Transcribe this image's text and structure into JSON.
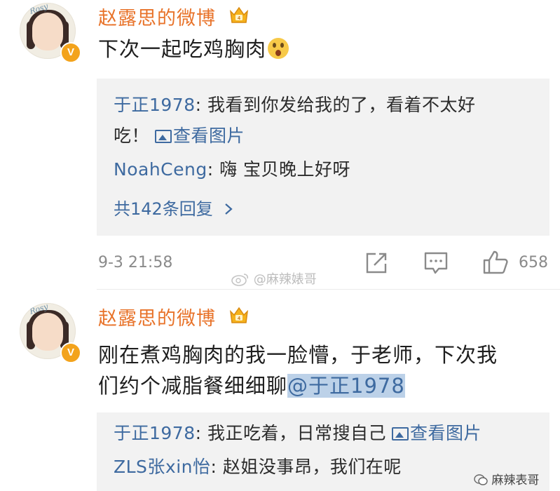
{
  "posts": [
    {
      "author": "赵露思的微博",
      "avatar_text": "Rosy",
      "verified": "V",
      "text": "下次一起吃鸡胸肉",
      "emoji": "surprised-face",
      "replies": [
        {
          "author": "于正1978",
          "sep": ":",
          "text": " 我看到你发给我的了，看着不太好",
          "text2": "吃！",
          "link": "查看图片"
        },
        {
          "author": "NoahCeng",
          "sep": ":",
          "text": " 嗨  宝贝晚上好呀"
        }
      ],
      "more_replies": "共142条回复",
      "time": "9-3 21:58",
      "likes": "658"
    },
    {
      "author": "赵露思的微博",
      "avatar_text": "Rosy",
      "verified": "V",
      "text_line1": "刚在煮鸡胸肉的我一脸懵，于老师，下次我",
      "text_line2": "们约个减脂餐细细聊",
      "mention": "@于正1978",
      "replies": [
        {
          "author": "于正1978",
          "sep": ":",
          "text": " 我正吃着，日常搜自己",
          "link": "查看图片"
        },
        {
          "author": "ZLS张xin怡",
          "sep": ":",
          "text": " 赵姐没事昂，我们在呢"
        }
      ]
    }
  ],
  "watermarks": {
    "center": "@麻辣婊哥",
    "corner": "麻辣表哥"
  },
  "colors": {
    "name": "#e8732a",
    "link": "#3e6aa0",
    "reply_bg": "#f2f2f2",
    "meta": "#8a8a8a"
  }
}
